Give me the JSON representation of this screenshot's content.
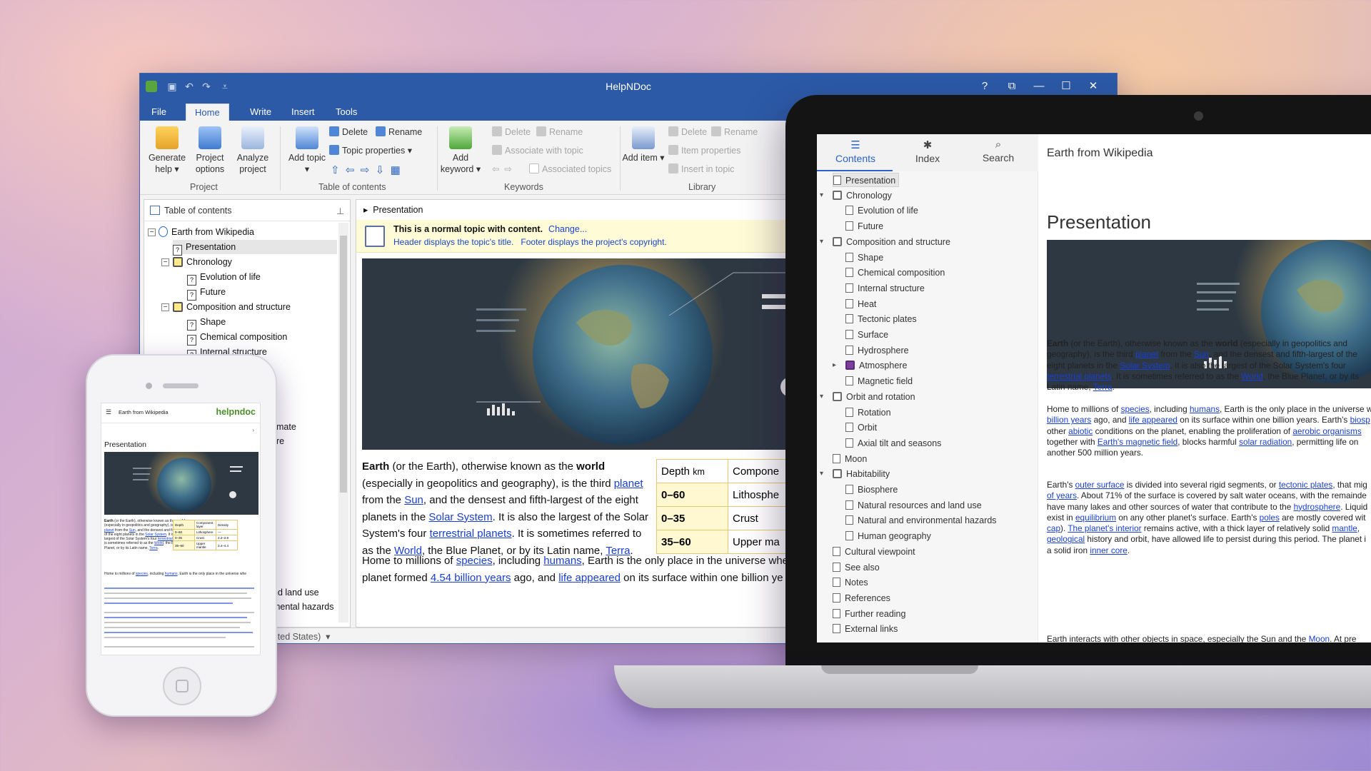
{
  "app": {
    "window_title": "HelpNDoc",
    "tabs": [
      "File",
      "Home",
      "Write",
      "Insert",
      "Tools"
    ],
    "active_tab": "Home",
    "window_controls": [
      "?",
      "⧉",
      "—",
      "☐",
      "✕"
    ]
  },
  "ribbon": {
    "project": {
      "label": "Project",
      "generate_help": "Generate help",
      "project_options": "Project options",
      "analyze_project": "Analyze project"
    },
    "toc": {
      "label": "Table of contents",
      "add_topic": "Add topic",
      "delete": "Delete",
      "rename": "Rename",
      "topic_properties": "Topic properties"
    },
    "keywords": {
      "label": "Keywords",
      "add_keyword": "Add keyword",
      "delete": "Delete",
      "rename": "Rename",
      "associate_with_topic": "Associate with topic",
      "associated_topics": "Associated topics"
    },
    "library": {
      "label": "Library",
      "add_item": "Add item",
      "delete": "Delete",
      "rename": "Rename",
      "item_properties": "Item properties",
      "insert_in_topic": "Insert in topic"
    }
  },
  "toc_panel": {
    "header": "Table of contents",
    "items": [
      "Earth from Wikipedia",
      "Presentation",
      "Chronology",
      "Evolution of life",
      "Future",
      "Composition and structure",
      "Shape",
      "Chemical composition"
    ],
    "partial_items": [
      "Internal structure",
      "mate",
      "re",
      "nd land use",
      "mental hazards"
    ],
    "status_language": "ited States)"
  },
  "editor": {
    "breadcrumb": "Presentation",
    "info_title": "This is a normal topic with content.",
    "info_change": "Change...",
    "info_header": "Header displays the topic's title.",
    "info_footer": "Footer displays the project's copyright.",
    "para1": {
      "earth": "Earth",
      "t1": " (or the Earth), otherwise known as the ",
      "world": "world",
      "t2": " (especially in geopolitics and geography), is the third ",
      "planet": "planet",
      "t3": " from the ",
      "sun": "Sun",
      "t4": ", and the densest and fifth-largest of the eight planets in the ",
      "solar_system": "Solar System",
      "t5": ". It is also the largest of the Solar System's four ",
      "terrestrial_planets": "terrestrial planets",
      "t6": ". It is sometimes referred to as the ",
      "world_link": "World",
      "t7": ", the Blue Planet, or by its Latin name, ",
      "terra": "Terra",
      "t8": "."
    },
    "para2_line1_a": "Home to millions of ",
    "species": "species",
    "para2_line1_b": ", including ",
    "humans": "humans",
    "para2_line1_c": ", Earth is the only place in the universe whe",
    "para2_line2_a": "planet formed ",
    "billion_years": "4.54 billion years",
    "para2_line2_b": " ago, and ",
    "life_appeared": "life appeared",
    "para2_line2_c": " on its surface within one billion ye",
    "table": {
      "header": [
        "Depth",
        "km",
        "Compone"
      ],
      "rows": [
        [
          "0–60",
          "Lithosphe"
        ],
        [
          "0–35",
          "Crust"
        ],
        [
          "35–60",
          "Upper ma"
        ]
      ]
    }
  },
  "laptop": {
    "tabs": [
      {
        "glyph": "☰",
        "label": "Contents"
      },
      {
        "glyph": "✱",
        "label": "Index"
      },
      {
        "glyph": "⌕",
        "label": "Search"
      }
    ],
    "header_title": "Earth from Wikipedia",
    "heading": "Presentation",
    "toc": [
      {
        "label": "Presentation",
        "type": "page",
        "level": 0
      },
      {
        "label": "Chronology",
        "type": "book",
        "level": 0
      },
      {
        "label": "Evolution of life",
        "type": "page",
        "level": 1
      },
      {
        "label": "Future",
        "type": "page",
        "level": 1
      },
      {
        "label": "Composition and structure",
        "type": "book",
        "level": 0
      },
      {
        "label": "Shape",
        "type": "page",
        "level": 1
      },
      {
        "label": "Chemical composition",
        "type": "page",
        "level": 1
      },
      {
        "label": "Internal structure",
        "type": "page",
        "level": 1
      },
      {
        "label": "Heat",
        "type": "page",
        "level": 1
      },
      {
        "label": "Tectonic plates",
        "type": "page",
        "level": 1
      },
      {
        "label": "Surface",
        "type": "page",
        "level": 1
      },
      {
        "label": "Hydrosphere",
        "type": "page",
        "level": 1
      },
      {
        "label": "Atmosphere",
        "type": "book-purple",
        "level": 1
      },
      {
        "label": "Magnetic field",
        "type": "page",
        "level": 1
      },
      {
        "label": "Orbit and rotation",
        "type": "book",
        "level": 0
      },
      {
        "label": "Rotation",
        "type": "page",
        "level": 1
      },
      {
        "label": "Orbit",
        "type": "page",
        "level": 1
      },
      {
        "label": "Axial tilt and seasons",
        "type": "page",
        "level": 1
      },
      {
        "label": "Moon",
        "type": "page",
        "level": 0
      },
      {
        "label": "Habitability",
        "type": "book",
        "level": 0
      },
      {
        "label": "Biosphere",
        "type": "page",
        "level": 1
      },
      {
        "label": "Natural resources and land use",
        "type": "page",
        "level": 1
      },
      {
        "label": "Natural and environmental hazards",
        "type": "page",
        "level": 1
      },
      {
        "label": "Human geography",
        "type": "page",
        "level": 1
      },
      {
        "label": "Cultural viewpoint",
        "type": "page",
        "level": 0
      },
      {
        "label": "See also",
        "type": "page",
        "level": 0
      },
      {
        "label": "Notes",
        "type": "page",
        "level": 0
      },
      {
        "label": "References",
        "type": "page",
        "level": 0
      },
      {
        "label": "Further reading",
        "type": "page",
        "level": 0
      },
      {
        "label": "External links",
        "type": "page",
        "level": 0
      }
    ],
    "p1": [
      "(or the Earth), otherwise known as the",
      "(especially in geopolitics and",
      "geography), is the third",
      "from the",
      ", and the densest and fifth-largest of the",
      "eight planets in the",
      ". It is also the largest of the Solar System's four",
      ". It is sometimes referred to as the",
      ", the Blue Planet, or by its",
      "Latin name,"
    ],
    "p2": [
      "Home to millions of",
      ", including",
      ", Earth is the only place in the universe w",
      "billion years",
      "ago, and",
      "life appeared",
      "on its surface within one billion years. Earth's",
      "biosp",
      "other",
      "abiotic",
      "conditions on the planet, enabling the proliferation of",
      "aerobic organisms",
      "together with",
      "Earth's magnetic field",
      ", blocks harmful",
      "solar radiation",
      ", permitting life on",
      "another 500 million years."
    ],
    "p3": [
      "Earth's",
      "outer surface",
      "is divided into several rigid segments, or",
      "tectonic plates",
      ", that mig",
      "of years",
      ". About 71% of the surface is covered by salt water oceans, with the remainde",
      "have many lakes and other sources of water that contribute to the",
      "hydrosphere",
      ". Liquid",
      "exist in",
      "equilibrium",
      "on any other planet's surface. Earth's",
      "poles",
      "are mostly covered wit",
      "cap",
      ").",
      "The planet's interior",
      "remains active, with a thick layer of relatively solid",
      "mantle",
      "geological",
      "history and orbit, have allowed life to persist during this period. The planet i",
      "a solid iron",
      "inner core",
      "Earth interacts with other objects in space, especially the Sun and the",
      "Moon",
      ". At pre"
    ]
  },
  "phone": {
    "header_title": "Earth from Wikipedia",
    "logo": "helpndoc",
    "heading": "Presentation",
    "table": [
      [
        "Depth",
        "Component layer",
        "Density"
      ],
      [
        "0–60",
        "Lithosphere",
        "—"
      ],
      [
        "0–35",
        "Crust",
        "2.2–2.9"
      ],
      [
        "35–60",
        "Upper mantle",
        "3.4–4.4"
      ]
    ]
  },
  "colors": {
    "ribbon_blue": "#2c5aa6",
    "link_blue": "#1a3fd0",
    "info_bar": "#fffbd6",
    "table_border": "#e5c970",
    "laptop_accent": "#2c63c6",
    "helpndoc_green": "#4a8f2a"
  }
}
